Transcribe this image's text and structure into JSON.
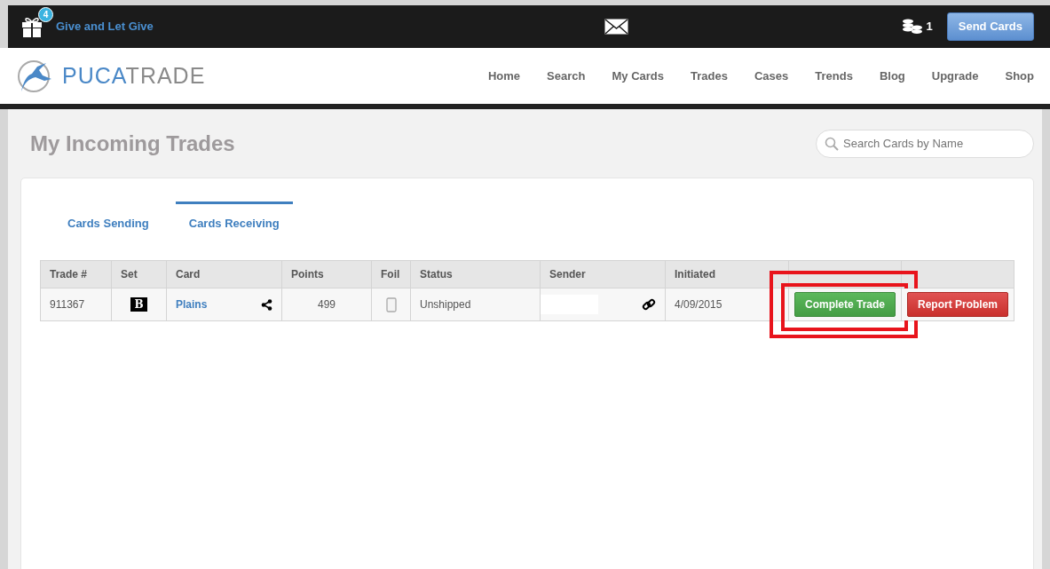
{
  "topbar": {
    "gift_badge": "4",
    "gift_link": "Give and Let Give",
    "coins": "1",
    "send_button": "Send Cards"
  },
  "logo": {
    "part_1": "PUCA",
    "part_2": "TRADE"
  },
  "nav": {
    "items": [
      "Home",
      "Search",
      "My Cards",
      "Trades",
      "Cases",
      "Trends",
      "Blog",
      "Upgrade",
      "Shop"
    ]
  },
  "page_title": "My Incoming Trades",
  "search": {
    "placeholder": "Search Cards by Name"
  },
  "tabs": [
    {
      "label": "Cards Sending",
      "selected": false
    },
    {
      "label": "Cards Receiving",
      "selected": true
    }
  ],
  "table": {
    "columns": [
      "Trade #",
      "Set",
      "Card",
      "Points",
      "Foil",
      "Status",
      "Sender",
      "Initiated"
    ],
    "rows": [
      {
        "trade": "911367",
        "set_symbol": "B",
        "card": "Plains",
        "points": "499",
        "status": "Unshipped",
        "initiated": "4/09/2015",
        "actions": [
          {
            "label": "Complete Trade",
            "kind": "success",
            "highlighted": true
          },
          {
            "label": "Report Problem",
            "kind": "danger",
            "highlighted": false
          }
        ]
      }
    ]
  }
}
